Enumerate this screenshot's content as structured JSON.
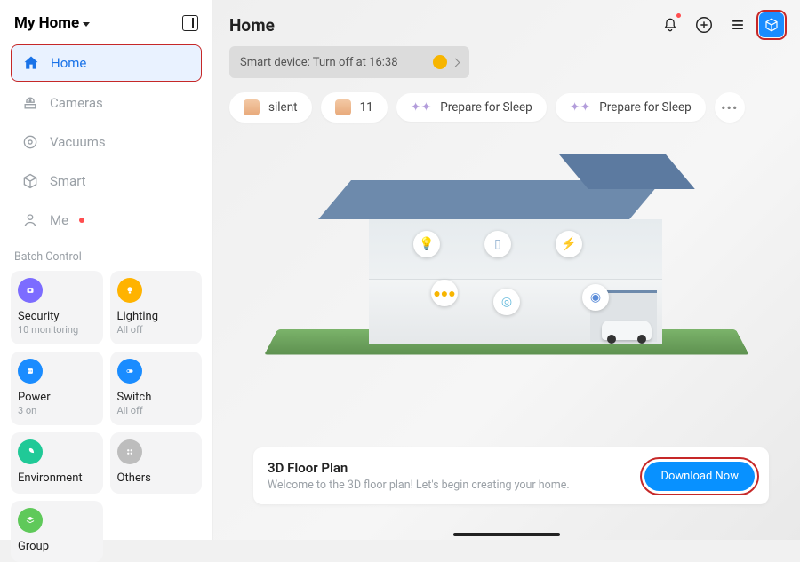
{
  "sidebar": {
    "dropdown_label": "My Home",
    "nav": [
      {
        "label": "Home"
      },
      {
        "label": "Cameras"
      },
      {
        "label": "Vacuums"
      },
      {
        "label": "Smart"
      },
      {
        "label": "Me"
      }
    ],
    "section_label": "Batch Control",
    "batch": [
      {
        "title": "Security",
        "sub": "10 monitoring",
        "color": "#7c6cff"
      },
      {
        "title": "Lighting",
        "sub": "All off",
        "color": "#ffb300"
      },
      {
        "title": "Power",
        "sub": "3 on",
        "color": "#1a8cff"
      },
      {
        "title": "Switch",
        "sub": "All off",
        "color": "#1a8cff"
      },
      {
        "title": "Environment",
        "sub": "",
        "color": "#20c997"
      },
      {
        "title": "Others",
        "sub": "",
        "color": "#bdbdbd"
      },
      {
        "title": "Group",
        "sub": "",
        "color": "#5fc95a"
      }
    ]
  },
  "main": {
    "title": "Home",
    "banner_text": "Smart device: Turn off at 16:38",
    "scenes": [
      {
        "label": "silent"
      },
      {
        "label": "11"
      },
      {
        "label": "Prepare for Sleep"
      },
      {
        "label": "Prepare for Sleep"
      }
    ],
    "floorplan": {
      "title": "3D Floor Plan",
      "subtitle": "Welcome to the 3D floor plan! Let's begin creating your home.",
      "download_label": "Download Now"
    }
  }
}
